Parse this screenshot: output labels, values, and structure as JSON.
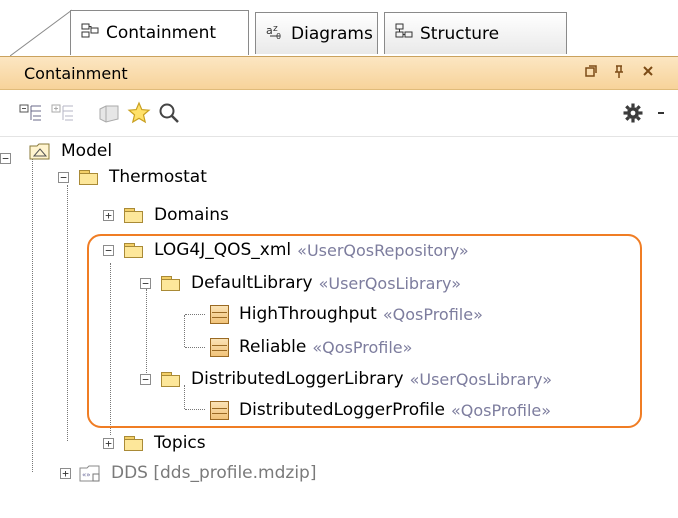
{
  "tabs": [
    {
      "label": "Containment",
      "icon": "containment-icon",
      "active": true
    },
    {
      "label": "Diagrams",
      "icon": "diagrams-icon",
      "active": false
    },
    {
      "label": "Structure",
      "icon": "structure-icon",
      "active": false
    }
  ],
  "panel": {
    "title": "Containment",
    "buttons": [
      "restore-icon",
      "pin-icon",
      "close-icon"
    ]
  },
  "toolbar": {
    "icons": [
      "collapse-all-icon",
      "expand-all-icon",
      "new-element-icon",
      "favorites-star-icon",
      "search-icon",
      "settings-gear-icon",
      "dropdown-arrow-icon"
    ]
  },
  "tree": {
    "model": "Model",
    "thermostat": "Thermostat",
    "domains": "Domains",
    "log4j": {
      "label": "LOG4J_QOS_xml",
      "stereotype": "«UserQosRepository»"
    },
    "default_library": {
      "label": "DefaultLibrary",
      "stereotype": "«UserQosLibrary»"
    },
    "high_throughput": {
      "label": "HighThroughput",
      "stereotype": "«QosProfile»"
    },
    "reliable": {
      "label": "Reliable",
      "stereotype": "«QosProfile»"
    },
    "distributed_library": {
      "label": "DistributedLoggerLibrary",
      "stereotype": "«UserQosLibrary»"
    },
    "distributed_profile": {
      "label": "DistributedLoggerProfile",
      "stereotype": "«QosProfile»"
    },
    "topics": "Topics",
    "dds": "DDS [dds_profile.mdzip]"
  },
  "colors": {
    "panel_header": "#f7d39a",
    "highlight": "#f07d24",
    "stereotype": "#7d7d9e"
  }
}
